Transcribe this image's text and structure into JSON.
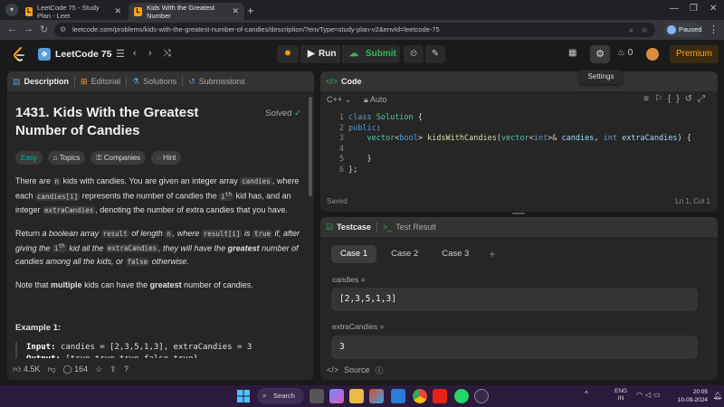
{
  "browser": {
    "tabs": [
      {
        "label": "LeetCode 75 - Study Plan - Leet",
        "close": "✕"
      },
      {
        "label": "Kids With the Greatest Number",
        "close": "✕"
      }
    ],
    "url": "leetcode.com/problems/kids-with-the-greatest-number-of-candies/description/?envType=study-plan-v2&envId=leetcode-75",
    "profile_label": "Paused"
  },
  "nav": {
    "study_plan": "LeetCode 75",
    "run_label": "Run",
    "submit_label": "Submit",
    "streak": "0",
    "premium_label": "Premium",
    "tooltip": "Settings",
    "colors": {
      "accent": "#ffa116",
      "submit": "#2cbb5d"
    }
  },
  "desc": {
    "tabs": [
      "Description",
      "Editorial",
      "Solutions",
      "Submissions"
    ],
    "title": "1431. Kids With the Greatest Number of Candies",
    "solved": "Solved",
    "chips": [
      "Easy",
      "Topics",
      "Companies",
      "Hint"
    ],
    "p1": {
      "a": "There are",
      "n": "n",
      "b": "kids with candies. You are given an integer array",
      "candies": "candies",
      "c": ", where each",
      "candies_i": "candies[i]",
      "d": "represents the number of candies the",
      "ith": "i",
      "th": "th",
      "e": "kid has, and an integer",
      "extra": "extraCandies",
      "f": ", denoting the number of extra candies that you have."
    },
    "p2": {
      "a": "Return",
      "b": "a boolean array",
      "result": "result",
      "c": "of length",
      "n": "n",
      "d": ", where",
      "result_i": "result[i]",
      "e": "is",
      "true": "true",
      "f": "if, after giving the",
      "ith": "i",
      "th": "th",
      "g": "kid all the",
      "extra": "extraCandies",
      "h": ", they will have the",
      "greatest": "greatest",
      "i": "number of candies among all the kids, or",
      "false": "false",
      "j": "otherwise."
    },
    "p3": {
      "a": "Note that",
      "multiple": "multiple",
      "b": "kids can have the",
      "greatest": "greatest",
      "c": "number of candies."
    },
    "example_title": "Example 1:",
    "example_input_label": "Input:",
    "example_input": "candies = [2,3,5,1,3], extraCandies = 3",
    "example_output_label": "Output:",
    "example_output": "[true,true,true,false,true]",
    "likes": "4.5K",
    "comments": "164"
  },
  "code": {
    "header": "Code",
    "language": "C++",
    "mode": "Auto",
    "lines": [
      "class Solution {",
      "public:",
      "    vector<bool> kidsWithCandies(vector<int>& candies, int extraCandies) {",
      "",
      "    }",
      "};"
    ],
    "status": "Saved",
    "cursor": "Ln 1, Col 1"
  },
  "test": {
    "tabs": [
      "Testcase",
      "Test Result"
    ],
    "cases": [
      "Case 1",
      "Case 2",
      "Case 3"
    ],
    "plus": "+",
    "candies_label": "candies =",
    "candies_value": "[2,3,5,1,3]",
    "extra_label": "extraCandies =",
    "extra_value": "3",
    "footer": "Source"
  },
  "taskbar": {
    "search": "Search",
    "lang_top": "ENG",
    "lang_bottom": "IN",
    "time": "20:05",
    "date": "10-09-2024"
  }
}
